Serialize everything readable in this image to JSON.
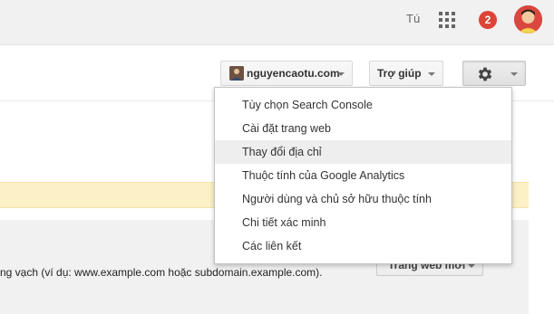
{
  "top_bar": {
    "user_short": "Tú",
    "notification_count": "2"
  },
  "toolbar": {
    "account_label": "nguyencaotu.com",
    "help_label": "Trợ giúp"
  },
  "settings_menu": {
    "items": [
      {
        "label": "Tùy chọn Search Console"
      },
      {
        "label": "Cài đặt trang web"
      },
      {
        "label": "Thay đổi địa chỉ",
        "highlighted": true
      },
      {
        "label": "Thuộc tính của Google Analytics"
      },
      {
        "label": "Người dùng và chủ sở hữu thuộc tính"
      },
      {
        "label": "Chi tiết xác minh"
      },
      {
        "label": "Các liên kết"
      }
    ]
  },
  "background": {
    "hint_text": "ng vạch (ví dụ: www.example.com hoặc subdomain.example.com).",
    "add_site_button": "Trang web mới"
  },
  "colors": {
    "notification": "#db4437",
    "banner": "#fcf0c7",
    "menu_highlight": "#eeeeee"
  },
  "icons": [
    "apps-grid-icon",
    "gear-icon",
    "chevron-down-icon"
  ]
}
